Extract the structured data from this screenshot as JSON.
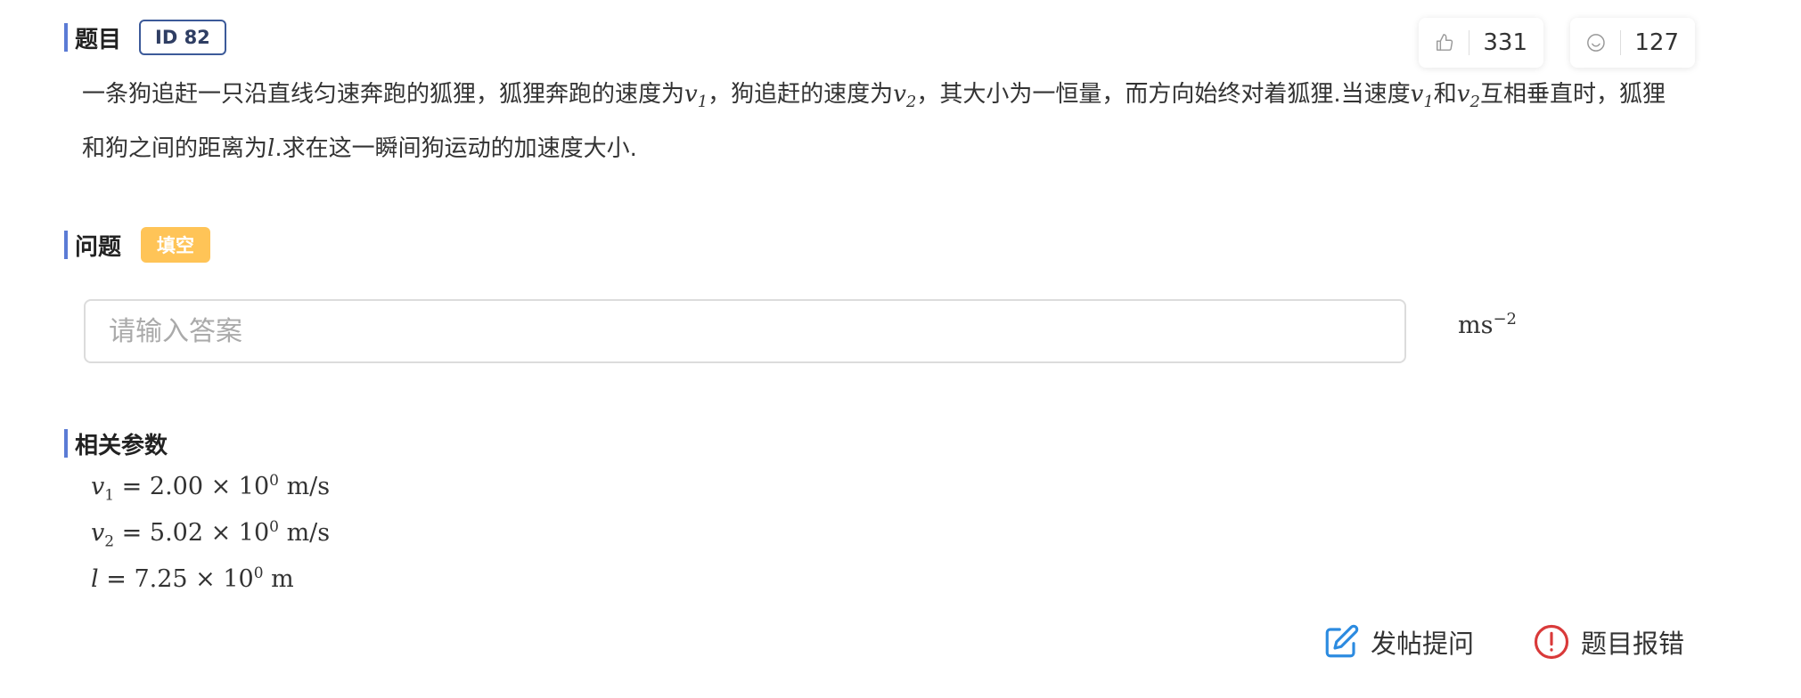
{
  "header": {
    "section_title": "题目",
    "id_badge": "ID 82"
  },
  "stats": {
    "like_icon": "thumbs-up-icon",
    "like_count": "331",
    "smile_icon": "smile-icon",
    "smile_count": "127"
  },
  "problem": {
    "line1_a": "一条狗追赶一只沿直线匀速奔跑的狐狸，狐狸奔跑的速度为",
    "sym_v": "v",
    "sub_1": "1",
    "sub_2": "2",
    "line1_b": "，狗追赶的速度为",
    "line1_c": "，其大小为一恒量，而方向始终对着狐狸.当速度",
    "line1_d": "和",
    "line1_e": "互相垂直时，狐狸",
    "line2_a": "和狗之间的距离为",
    "sym_l": "l",
    "line2_b": ".求在这一瞬间狗运动的加速度大小."
  },
  "question": {
    "section_title": "问题",
    "type_badge": "填空",
    "input_placeholder": "请输入答案",
    "input_value": "",
    "unit_base": "ms",
    "unit_exp": "−2"
  },
  "params": {
    "section_title": "相关参数",
    "rows": [
      {
        "symbol": "v",
        "sub": "1",
        "eq": " = ",
        "value": "2.00 × 10",
        "exp": "0",
        "unit": " m/s"
      },
      {
        "symbol": "v",
        "sub": "2",
        "eq": " = ",
        "value": "5.02 × 10",
        "exp": "0",
        "unit": " m/s"
      },
      {
        "symbol": "l",
        "sub": "",
        "eq": " = ",
        "value": "7.25 × 10",
        "exp": "0",
        "unit": " m"
      }
    ]
  },
  "actions": {
    "post_label": "发帖提问",
    "post_icon": "edit-icon",
    "report_label": "题目报错",
    "report_icon": "alert-circle-icon"
  },
  "colors": {
    "heading_bar": "#5b7bd5",
    "id_badge_border": "#3c5a99",
    "type_badge": "#ffc457",
    "edit_icon": "#2c8be0",
    "report_icon": "#d93a3a"
  }
}
